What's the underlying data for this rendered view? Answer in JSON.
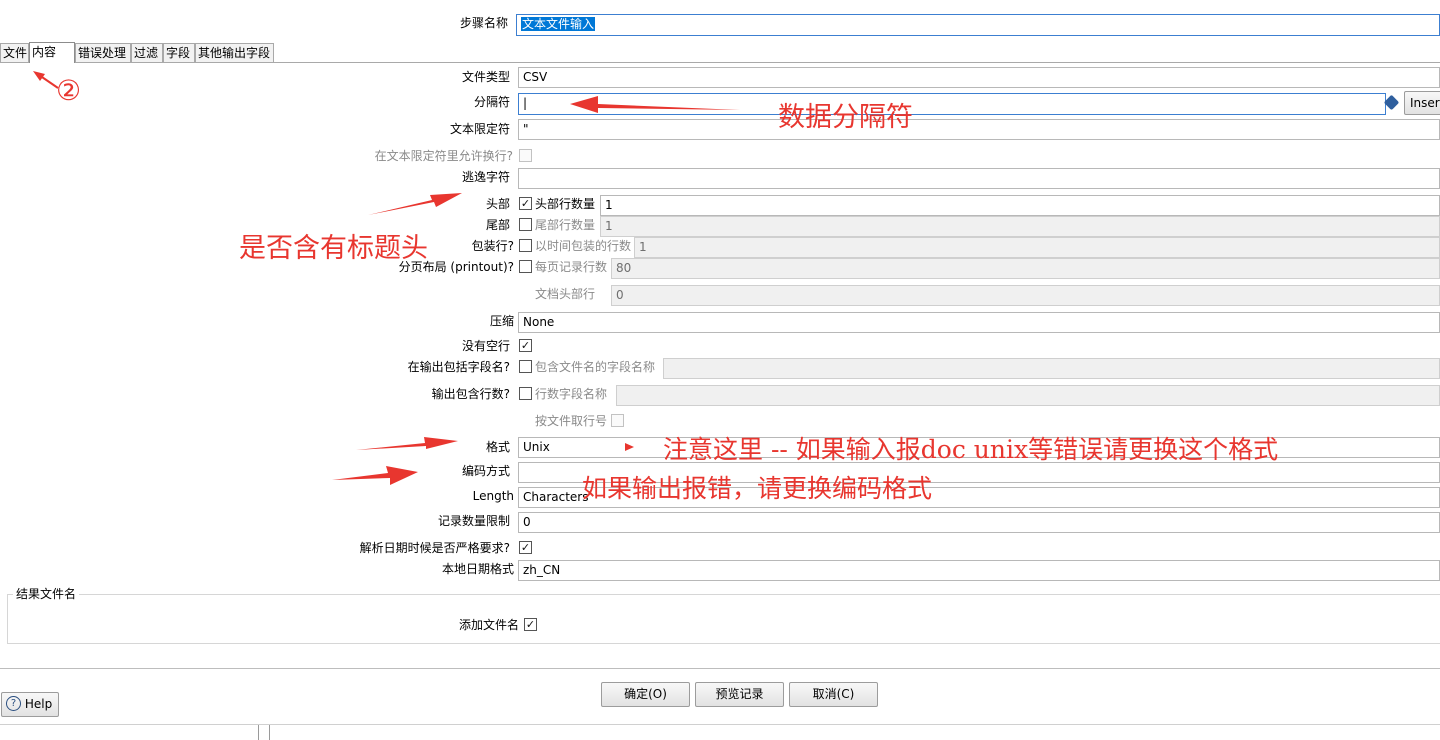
{
  "step": {
    "label": "步骤名称",
    "value": "文本文件输入"
  },
  "tabs": [
    "文件",
    "内容",
    "错误处理",
    "过滤",
    "字段",
    "其他输出字段"
  ],
  "form": {
    "file_type": {
      "label": "文件类型",
      "value": "CSV"
    },
    "separator": {
      "label": "分隔符",
      "value": "|",
      "insert_label": "Insert"
    },
    "enclosure": {
      "label": "文本限定符",
      "value": "\""
    },
    "break_in_enclosure": {
      "label": "在文本限定符里允许换行?",
      "checked": false
    },
    "escape": {
      "label": "逃逸字符",
      "value": ""
    },
    "header": {
      "label": "头部",
      "checked": true,
      "count_label": "头部行数量",
      "count_value": "1"
    },
    "footer": {
      "label": "尾部",
      "checked": false,
      "count_label": "尾部行数量",
      "count_value": "1"
    },
    "wrap": {
      "label": "包装行?",
      "checked": false,
      "count_label": "以时间包装的行数",
      "count_value": "1"
    },
    "paged": {
      "label": "分页布局 (printout)?",
      "checked": false,
      "per_page_label": "每页记录行数",
      "per_page_value": "80",
      "doc_header_label": "文档头部行",
      "doc_header_value": "0"
    },
    "compression": {
      "label": "压缩",
      "value": "None"
    },
    "no_empty_rows": {
      "label": "没有空行",
      "checked": true
    },
    "include_filename": {
      "label": "在输出包括字段名?",
      "checked": false,
      "field_label": "包含文件名的字段名称",
      "field_value": ""
    },
    "include_rownum": {
      "label": "输出包含行数?",
      "checked": false,
      "field_label": "行数字段名称",
      "field_value": ""
    },
    "rownum_by_file": {
      "label": "按文件取行号",
      "checked": false
    },
    "format": {
      "label": "格式",
      "value": "Unix"
    },
    "encoding": {
      "label": "编码方式",
      "value": ""
    },
    "length": {
      "label": "Length",
      "value": "Characters"
    },
    "limit": {
      "label": "记录数量限制",
      "value": "0"
    },
    "lenient_dates": {
      "label": "解析日期时候是否严格要求?",
      "checked": true
    },
    "locale": {
      "label": "本地日期格式",
      "value": "zh_CN"
    }
  },
  "result_group": {
    "title": "结果文件名",
    "add_filename_label": "添加文件名",
    "add_filename_checked": true
  },
  "buttons": {
    "ok": "确定(O)",
    "preview": "预览记录",
    "cancel": "取消(C)",
    "help": "Help"
  },
  "annotations": {
    "circle_two": "②",
    "separator_note": "数据分隔符",
    "header_note": "是否含有标题头",
    "format_note": "注意这里  -- 如果输入报doc unix等错误请更换这个格式",
    "encoding_note": "如果输出报错，请更换编码格式"
  },
  "colors": {
    "annotation": "#e8362f",
    "selection": "#0078d7",
    "focus_border": "#3c7fd1"
  }
}
